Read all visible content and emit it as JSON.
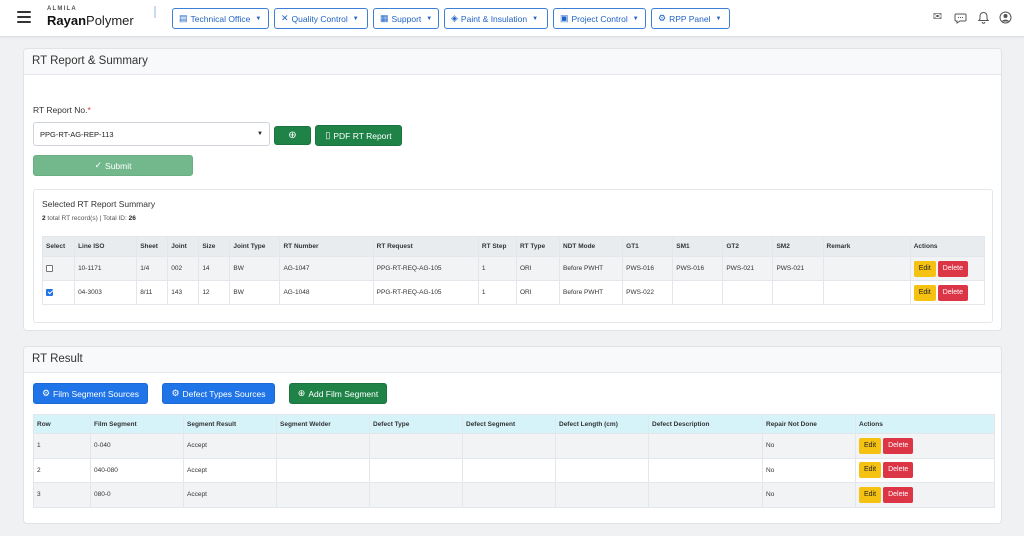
{
  "brand": {
    "small": "ALMILA",
    "main_bold": "Rayan",
    "main_rest": "Polymer"
  },
  "nav": [
    {
      "label": "Technical Office",
      "icon": "document-icon",
      "glyph": "▤"
    },
    {
      "label": "Quality Control",
      "icon": "tools-icon",
      "glyph": "✕"
    },
    {
      "label": "Support",
      "icon": "grid-icon",
      "glyph": "▦"
    },
    {
      "label": "Paint & Insulation",
      "icon": "paint-bucket-icon",
      "glyph": "◈"
    },
    {
      "label": "Project Control",
      "icon": "chart-icon",
      "glyph": "▣"
    },
    {
      "label": "RPP Panel",
      "icon": "gear-icon",
      "glyph": "⚙"
    }
  ],
  "card1": {
    "title": "RT Report & Summary",
    "report_label": "RT Report No.",
    "report_required": "*",
    "report_value": "PPG-RT-AG-REP-113",
    "add_icon": "⊕",
    "pdf_label": "PDF RT Report",
    "submit_label": "Submit",
    "summary_title": "Selected RT Report Summary",
    "summary_count": "2",
    "summary_count_text": " total RT record(s)   | Total ID: ",
    "summary_total_id": "26",
    "columns": [
      "Select",
      "Line ISO",
      "Sheet",
      "Joint",
      "Size",
      "Joint Type",
      "RT Number",
      "RT Request",
      "RT Step",
      "RT Type",
      "NDT Mode",
      "GT1",
      "SM1",
      "GT2",
      "SM2",
      "Remark",
      "Actions"
    ],
    "rows": [
      {
        "checked": false,
        "cells": [
          "10-1171",
          "1/4",
          "002",
          "14",
          "BW",
          "AG-1047",
          "PPG-RT-REQ-AG-105",
          "1",
          "ORI",
          "Before PWHT",
          "PWS-016",
          "PWS-016",
          "PWS-021",
          "PWS-021",
          ""
        ]
      },
      {
        "checked": true,
        "cells": [
          "04-3003",
          "8/11",
          "143",
          "12",
          "BW",
          "AG-1048",
          "PPG-RT-REQ-AG-105",
          "1",
          "ORI",
          "Before PWHT",
          "PWS-022",
          "",
          "",
          "",
          ""
        ]
      }
    ],
    "edit_label": "Edit",
    "delete_label": "Delete"
  },
  "card2": {
    "title": "RT Result",
    "btn_film_sources": "Film Segment Sources",
    "btn_defect_sources": "Defect Types Sources",
    "btn_add_film": "Add Film Segment",
    "columns": [
      "Row",
      "Film Segment",
      "Segment Result",
      "Segment Welder",
      "Defect Type",
      "Defect Segment",
      "Defect Length (cm)",
      "Defect Description",
      "Repair Not Done",
      "Actions"
    ],
    "rows": [
      [
        "1",
        "0-040",
        "Accept",
        "",
        "",
        "",
        "",
        "",
        "No"
      ],
      [
        "2",
        "040-080",
        "Accept",
        "",
        "",
        "",
        "",
        "",
        "No"
      ],
      [
        "3",
        "080-0",
        "Accept",
        "",
        "",
        "",
        "",
        "",
        "No"
      ]
    ],
    "edit_label": "Edit",
    "delete_label": "Delete"
  },
  "colors": {
    "primary": "#1f74e8",
    "success": "#1f8348",
    "warning": "#f5c211",
    "danger": "#dc3545"
  }
}
